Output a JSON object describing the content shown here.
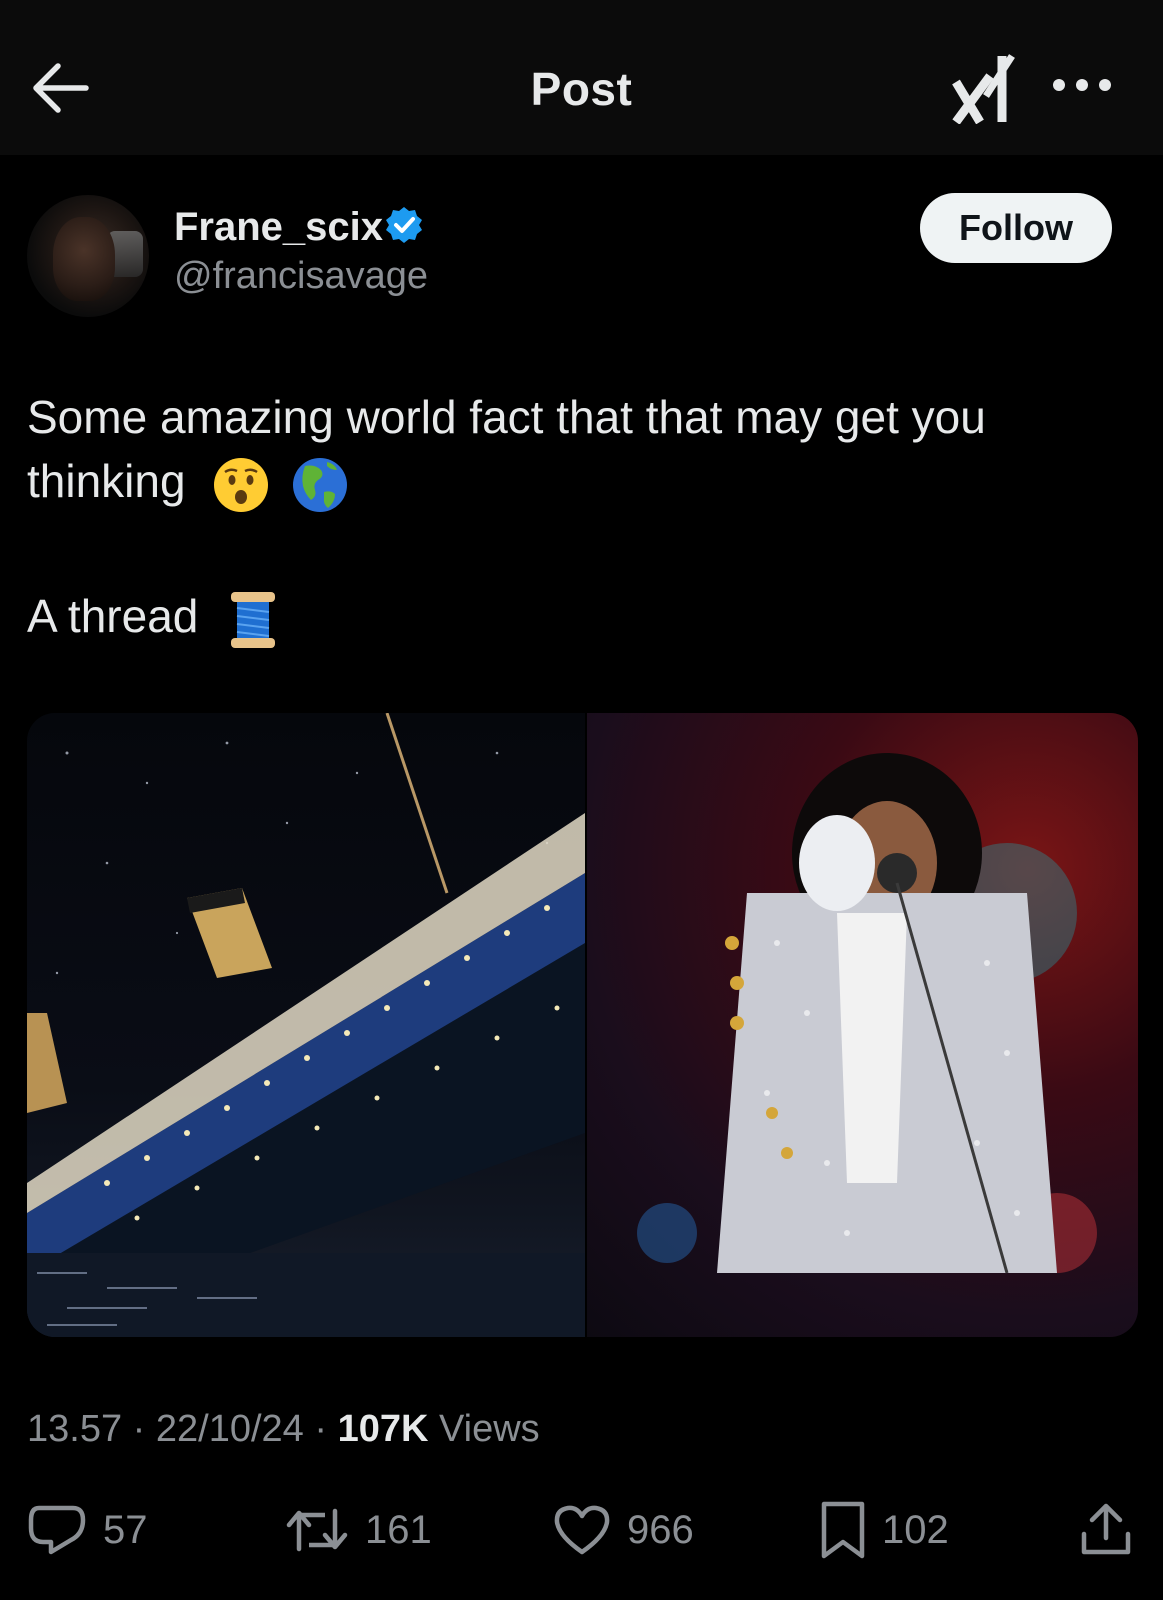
{
  "header": {
    "title": "Post",
    "back_icon": "arrow-left-icon",
    "grok_icon": "grok-logo-icon",
    "more_icon": "more-horizontal-icon"
  },
  "author": {
    "display_name": "Frane_scix",
    "handle": "@francisavage",
    "verified": true,
    "follow_label": "Follow"
  },
  "post": {
    "text_line1": "Some amazing world fact that that may get you",
    "text_line2": "thinking",
    "text_line2_emojis": [
      "hushed-face-emoji",
      "globe-americas-emoji"
    ],
    "text_line3": "A thread",
    "text_line3_emoji": "spool-of-thread-emoji",
    "media": [
      {
        "kind": "photo",
        "subject": "titanic-sinking"
      },
      {
        "kind": "photo",
        "subject": "performer-sequined-jacket"
      }
    ]
  },
  "meta": {
    "time": "13.57",
    "date": "22/10/24",
    "views_count": "107K",
    "views_label": "Views",
    "separator": "·"
  },
  "actions": {
    "replies": "57",
    "reposts": "161",
    "likes": "966",
    "bookmarks": "102"
  },
  "colors": {
    "background": "#000000",
    "header_bg": "#0b0b0b",
    "text_primary": "#e7e9ea",
    "text_secondary": "#8b8f94",
    "verified_blue": "#1d9bf0",
    "follow_bg": "#eff3f4"
  }
}
